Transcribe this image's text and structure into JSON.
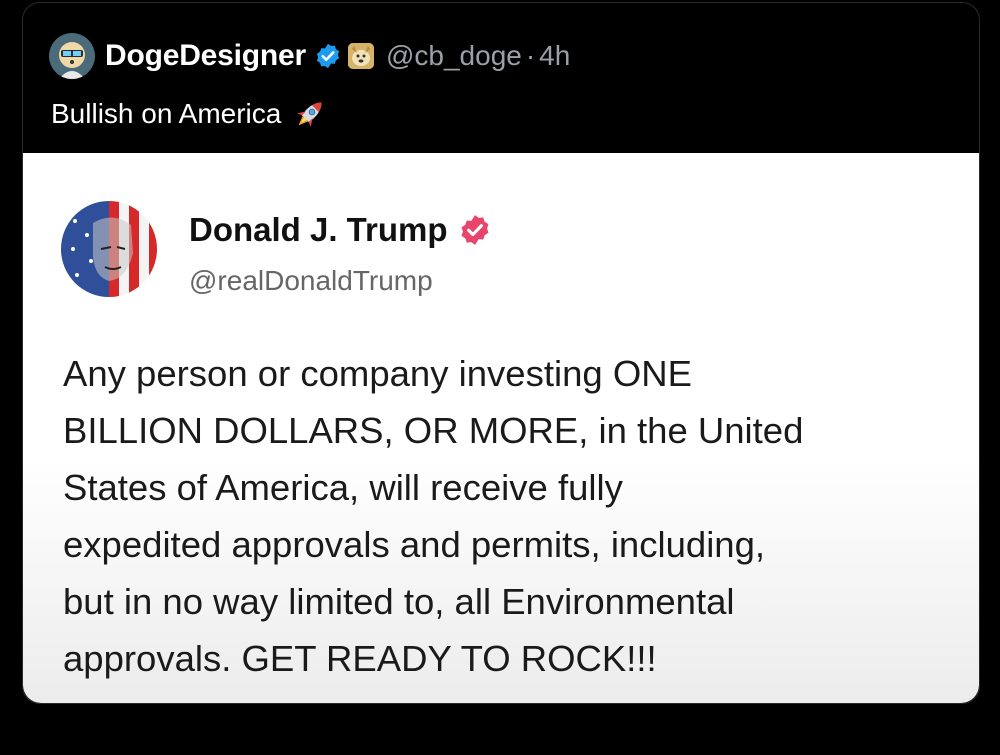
{
  "post": {
    "author_name": "DogeDesigner",
    "handle": "@cb_doge",
    "separator": "·",
    "time": "4h",
    "text": "Bullish on America",
    "emoji": "rocket-icon"
  },
  "quoted_post": {
    "author_name": "Donald J. Trump",
    "handle": "@realDonaldTrump",
    "body": "Any person or company investing ONE\nBILLION DOLLARS, OR MORE, in the United\nStates of America, will receive fully\nexpedited approvals and permits, including,\nbut in no way limited to, all Environmental\napprovals. GET READY TO ROCK!!!"
  },
  "colors": {
    "background": "#000000",
    "verified_blue": "#1d9bf0",
    "verified_pink": "#e8456b"
  }
}
